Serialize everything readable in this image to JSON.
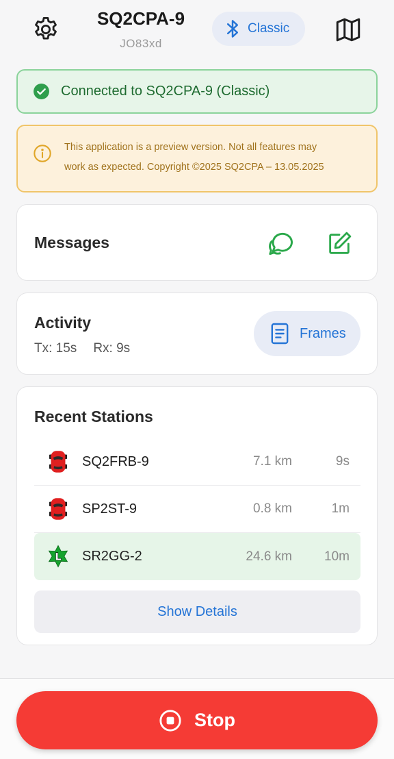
{
  "header": {
    "callsign": "SQ2CPA-9",
    "locator": "JO83xd",
    "connection_mode": "Classic",
    "settings_icon": "gear-icon",
    "map_icon": "map-icon",
    "bluetooth_icon": "bluetooth-icon"
  },
  "status_banner": {
    "text": "Connected to SQ2CPA-9 (Classic)",
    "icon": "check-circle-icon",
    "color": "#1e6b30"
  },
  "notice_banner": {
    "line1": "This application is a preview version. Not all features may",
    "line2": "work as expected. Copyright ©2025 SQ2CPA – 13.05.2025",
    "icon": "info-circle-icon",
    "color": "#a0721c"
  },
  "messages_card": {
    "title": "Messages",
    "chat_icon": "chat-bubbles-icon",
    "compose_icon": "compose-icon"
  },
  "activity_card": {
    "title": "Activity",
    "tx": "Tx: 15s",
    "rx": "Rx: 9s",
    "frames_label": "Frames",
    "frames_icon": "document-icon"
  },
  "recent_stations": {
    "title": "Recent Stations",
    "stations": [
      {
        "name": "SQ2FRB-9",
        "distance": "7.1 km",
        "age": "9s",
        "icon": "car-icon"
      },
      {
        "name": "SP2ST-9",
        "distance": "0.8 km",
        "age": "1m",
        "icon": "car-icon"
      },
      {
        "name": "SR2GG-2",
        "distance": "24.6 km",
        "age": "10m",
        "icon": "digipeater-star-icon",
        "icon_letter": "L"
      }
    ],
    "details_label": "Show Details"
  },
  "footer": {
    "stop_label": "Stop",
    "stop_icon": "stop-circle-icon",
    "stop_color": "#f53b35"
  }
}
